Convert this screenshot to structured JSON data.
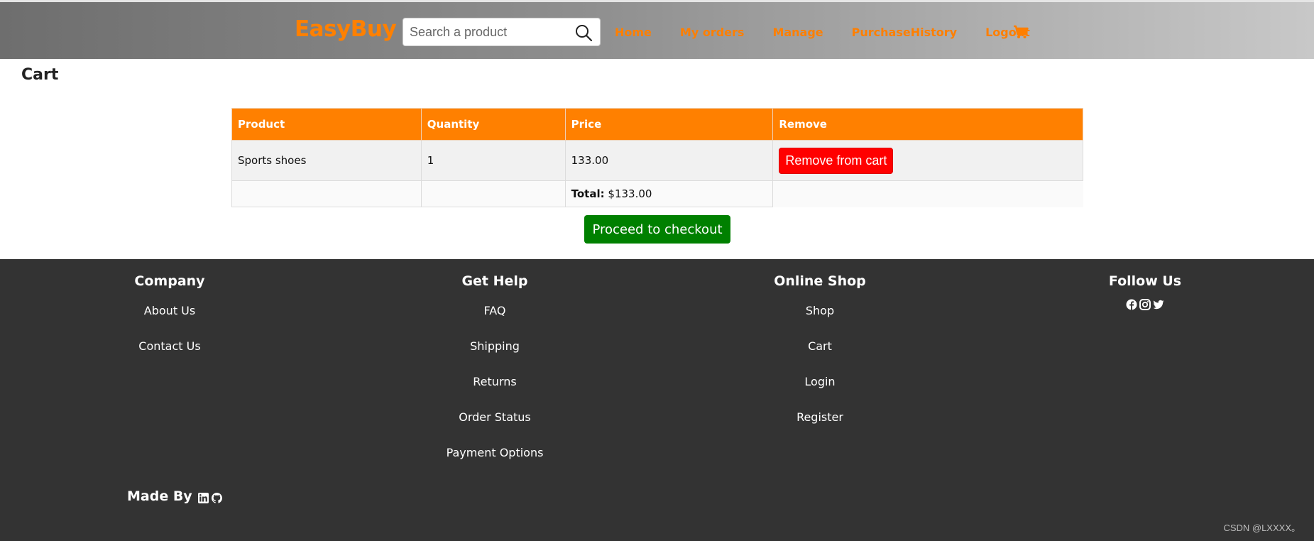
{
  "header": {
    "brand": "EasyBuy",
    "search": {
      "placeholder": "Search a product",
      "value": ""
    },
    "nav": [
      "Home",
      "My orders",
      "Manage",
      "PurchaseHistory",
      "Logout"
    ],
    "colors": {
      "brand": "#ff8000",
      "nav": "#ff7f00"
    }
  },
  "page": {
    "title": "Cart"
  },
  "cart": {
    "columns": [
      "Product",
      "Quantity",
      "Price",
      "Remove"
    ],
    "items": [
      {
        "product": "Sports shoes",
        "quantity": "1",
        "price": "133.00",
        "remove_label": "Remove from cart"
      }
    ],
    "total_label": "Total:",
    "total_value": "$133.00",
    "checkout_label": "Proceed to checkout",
    "colors": {
      "header_bg": "#ff8000",
      "remove": "#ff0000",
      "checkout": "#008000"
    }
  },
  "footer": {
    "company": {
      "title": "Company",
      "links": [
        "About Us",
        "Contact Us"
      ]
    },
    "help": {
      "title": "Get Help",
      "links": [
        "FAQ",
        "Shipping",
        "Returns",
        "Order Status",
        "Payment Options"
      ]
    },
    "shop": {
      "title": "Online Shop",
      "links": [
        "Shop",
        "Cart",
        "Login",
        "Register"
      ]
    },
    "follow": {
      "title": "Follow Us",
      "icons": [
        "facebook-icon",
        "instagram-icon",
        "twitter-icon"
      ]
    },
    "made_by": {
      "label": "Made By",
      "icons": [
        "linkedin-icon",
        "github-icon"
      ]
    },
    "watermark": "CSDN @LXXXX。"
  }
}
